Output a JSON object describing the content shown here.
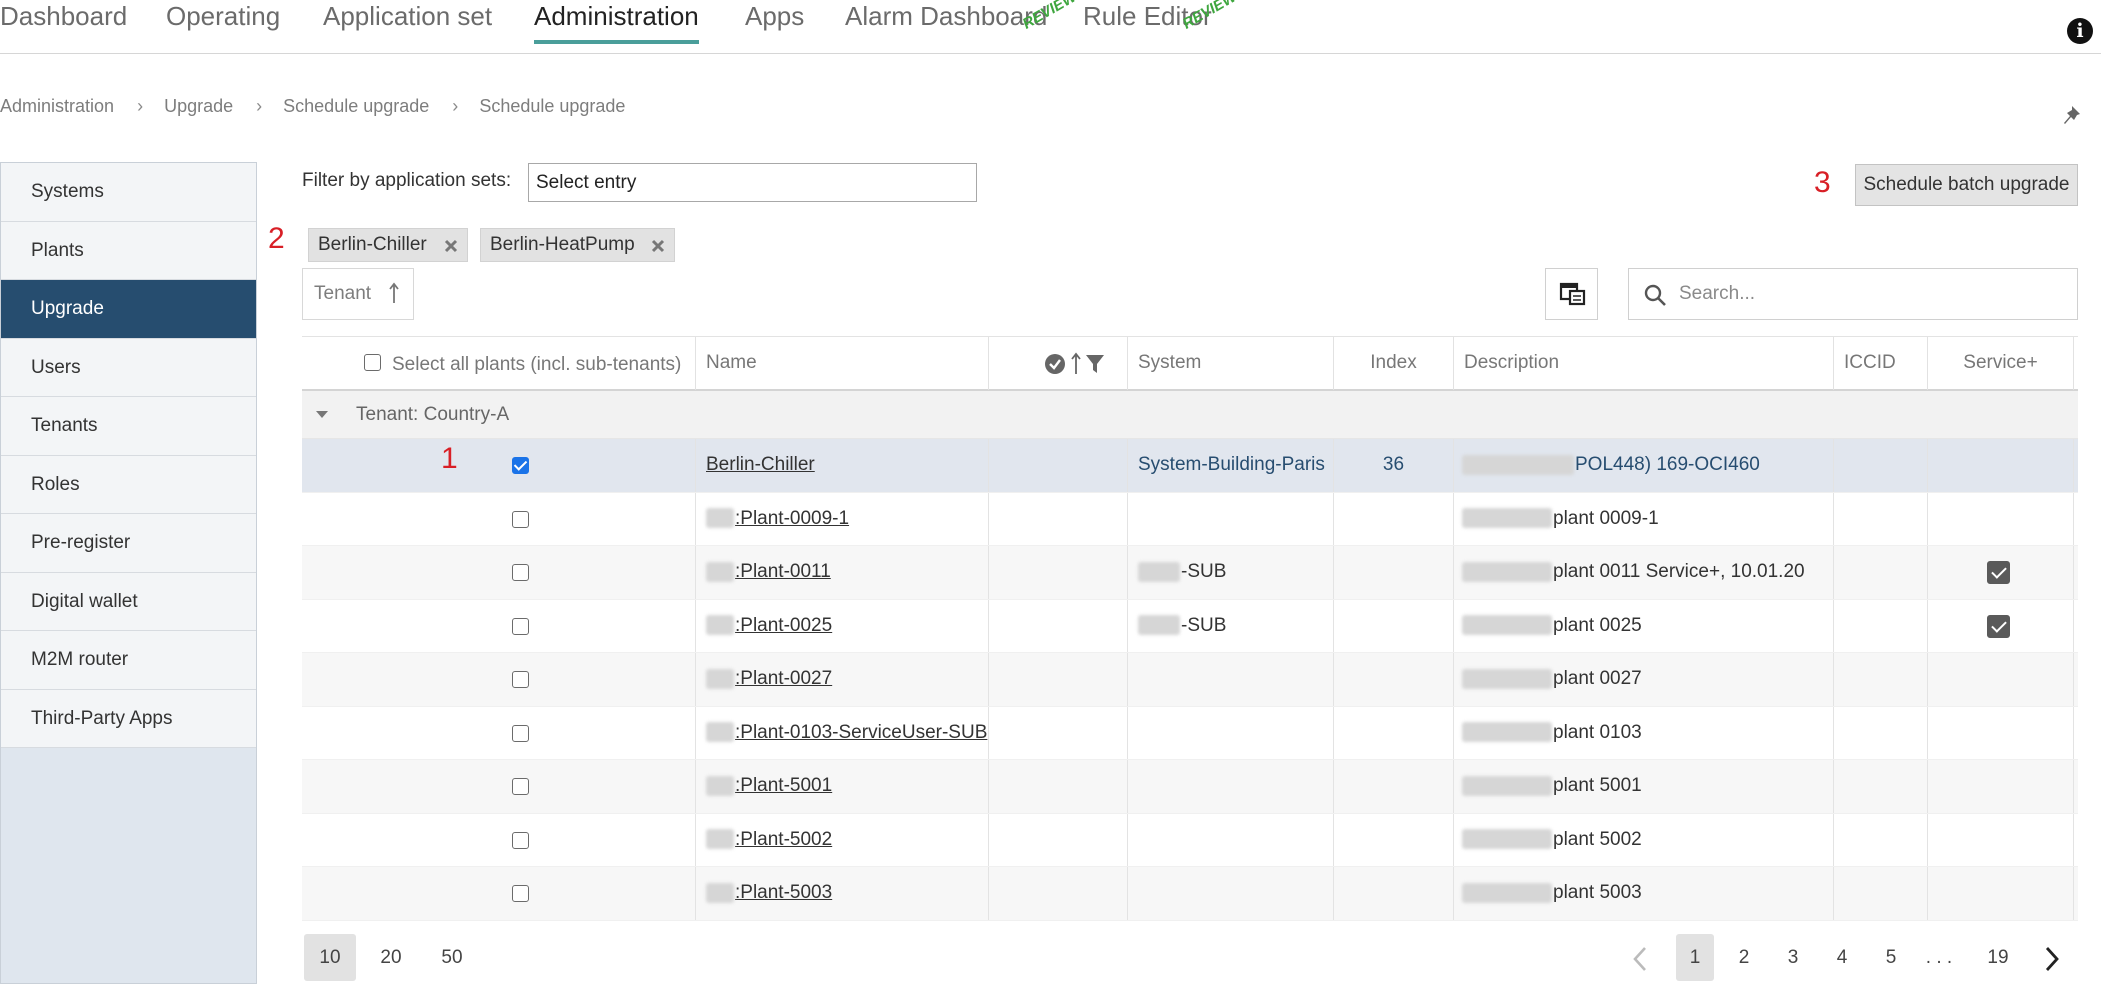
{
  "nav": {
    "items": [
      "Dashboard",
      "Operating",
      "Application set",
      "Administration",
      "Apps",
      "Alarm Dashboard",
      "Rule Editor"
    ],
    "preview_label": "REVIEW"
  },
  "breadcrumb": [
    "Administration",
    "Upgrade",
    "Schedule upgrade",
    "Schedule upgrade"
  ],
  "sidebar": [
    "Systems",
    "Plants",
    "Upgrade",
    "Users",
    "Tenants",
    "Roles",
    "Pre-register",
    "Digital wallet",
    "M2M router",
    "Third-Party Apps"
  ],
  "filter": {
    "label": "Filter by application sets:",
    "value": "Select entry"
  },
  "annotations": [
    "1",
    "2",
    "3"
  ],
  "batch_button": "Schedule batch upgrade",
  "chips": [
    "Berlin-Chiller",
    "Berlin-HeatPump"
  ],
  "tenant_sort": "Tenant",
  "search_placeholder": "Search...",
  "table": {
    "select_all": "Select all plants (incl. sub-tenants)",
    "headers": [
      "Name",
      "System",
      "Index",
      "Description",
      "ICCID",
      "Service+"
    ],
    "group": "Tenant: Country-A",
    "rows": [
      {
        "name": "Berlin-Chiller",
        "system": "System-Building-Paris",
        "index": "36",
        "desc": "POL448) 169-OCI460",
        "checked": true,
        "service": false
      },
      {
        "name": ":Plant-0009-1",
        "system": "",
        "index": "",
        "desc": "plant 0009-1",
        "checked": false,
        "service": false
      },
      {
        "name": ":Plant-0011",
        "system": "-SUB",
        "index": "",
        "desc": "plant 0011 Service+, 10.01.20",
        "checked": false,
        "service": true
      },
      {
        "name": ":Plant-0025",
        "system": "-SUB",
        "index": "",
        "desc": "plant 0025",
        "checked": false,
        "service": true
      },
      {
        "name": ":Plant-0027",
        "system": "",
        "index": "",
        "desc": "plant 0027",
        "checked": false,
        "service": false
      },
      {
        "name": ":Plant-0103-ServiceUser-SUB",
        "system": "",
        "index": "",
        "desc": "plant 0103",
        "checked": false,
        "service": false
      },
      {
        "name": ":Plant-5001",
        "system": "",
        "index": "",
        "desc": "plant 5001",
        "checked": false,
        "service": false
      },
      {
        "name": ":Plant-5002",
        "system": "",
        "index": "",
        "desc": "plant 5002",
        "checked": false,
        "service": false
      },
      {
        "name": ":Plant-5003",
        "system": "",
        "index": "",
        "desc": "plant 5003",
        "checked": false,
        "service": false
      }
    ]
  },
  "page_sizes": [
    "10",
    "20",
    "50"
  ],
  "pagination": [
    "1",
    "2",
    "3",
    "4",
    "5",
    ". . .",
    "19"
  ],
  "colors": {
    "accent": "#4a9e9a",
    "sidebar_active": "#264d6f",
    "annotation": "#d81f26",
    "checkbox": "#1a73e8"
  }
}
